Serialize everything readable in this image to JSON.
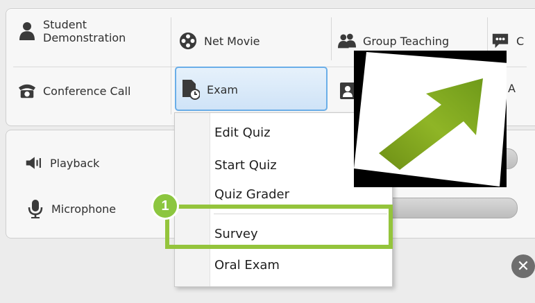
{
  "toolbar": {
    "student_demo": [
      "Student",
      "Demonstration"
    ],
    "net_movie": "Net Movie",
    "group_teaching": "Group Teaching",
    "truncated_top": "C",
    "conference_call": "Conference Call",
    "exam": "Exam",
    "truncated_bottom": "A"
  },
  "audio": {
    "playback": "Playback",
    "microphone": "Microphone"
  },
  "exam_menu": {
    "items": [
      "Edit Quiz",
      "Start Quiz",
      "Quiz Grader",
      "Survey",
      "Oral Exam"
    ]
  },
  "callout": {
    "number": "1",
    "highlight_color": "#94c43c"
  },
  "icons": {
    "student": "person-icon",
    "movie": "film-reel-icon",
    "group": "group-icon",
    "chat": "chat-bubble-icon",
    "phone": "telephone-icon",
    "exam": "exam-document-icon",
    "speaker": "speaker-icon",
    "mic": "microphone-icon",
    "close": "close-icon",
    "arrow": "green-arrow-icon"
  }
}
